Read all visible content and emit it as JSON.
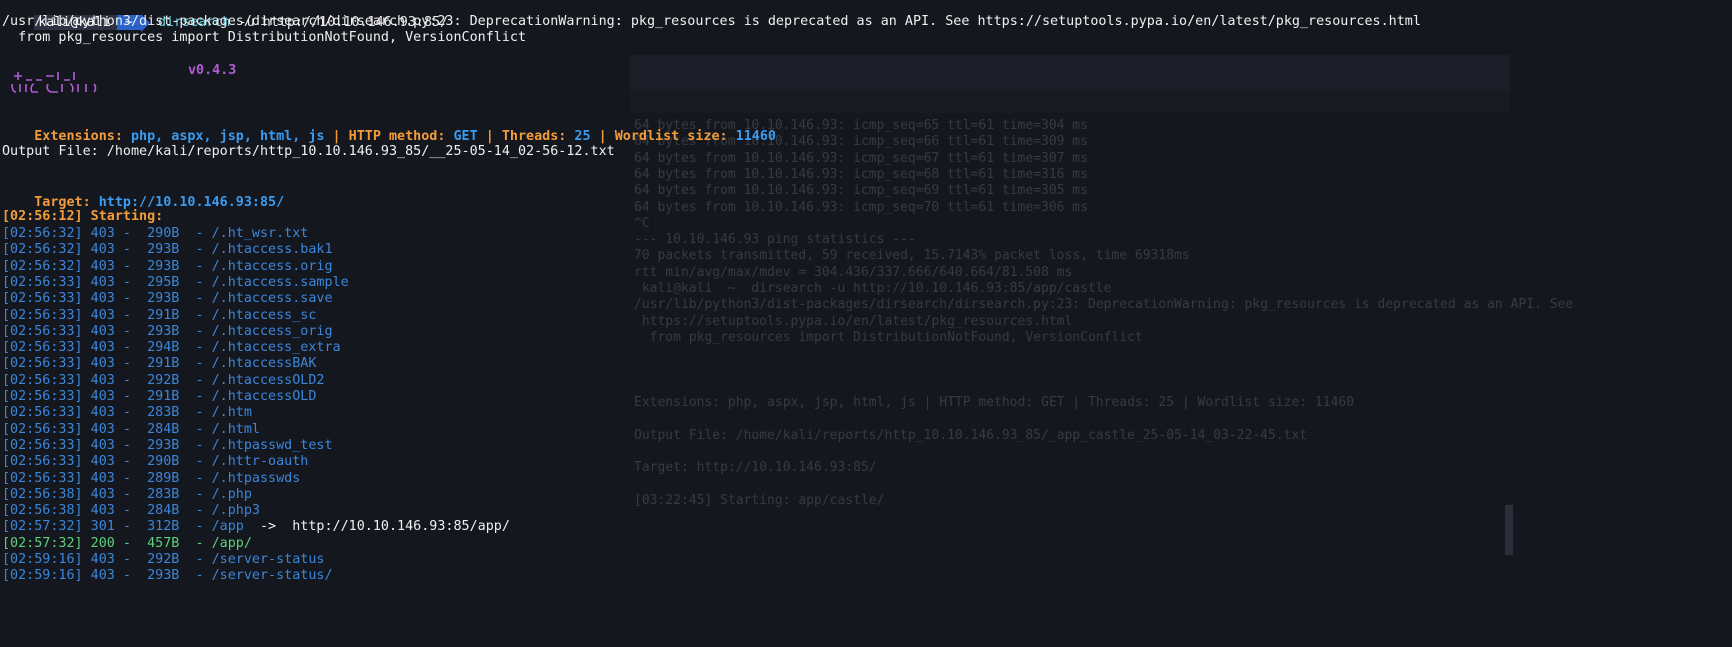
{
  "prompt": {
    "user": "kali@kali",
    "dir": "~",
    "command": "dirsearch",
    "args": "-u http://10.10.146.93:85/"
  },
  "warning": {
    "line1": "/usr/lib/python3/dist-packages/dirsearch/dirsearch.py:23: DeprecationWarning: pkg_resources is deprecated as an API. See https://setuptools.pypa.io/en/latest/pkg_resources.html",
    "line2": "  from pkg_resources import DistributionNotFound, VersionConflict"
  },
  "banner": {
    "version": "v0.4.3"
  },
  "config": {
    "ext_label": "Extensions:",
    "ext_value": "php, aspx, jsp, html, js",
    "sep": "|",
    "method_label": "HTTP method:",
    "method_value": "GET",
    "threads_label": "Threads:",
    "threads_value": "25",
    "wordlist_label": "Wordlist size:",
    "wordlist_value": "11460"
  },
  "output_file": "Output File: /home/kali/reports/http_10.10.146.93_85/__25-05-14_02-56-12.txt",
  "target": {
    "label": "Target:",
    "value": "http://10.10.146.93:85/"
  },
  "starting": "[02:56:12] Starting:",
  "results": [
    {
      "text": "[02:56:32] 403 -  290B  - /.ht_wsr.txt",
      "status": "403"
    },
    {
      "text": "[02:56:32] 403 -  293B  - /.htaccess.bak1",
      "status": "403"
    },
    {
      "text": "[02:56:32] 403 -  293B  - /.htaccess.orig",
      "status": "403"
    },
    {
      "text": "[02:56:33] 403 -  295B  - /.htaccess.sample",
      "status": "403"
    },
    {
      "text": "[02:56:33] 403 -  293B  - /.htaccess.save",
      "status": "403"
    },
    {
      "text": "[02:56:33] 403 -  291B  - /.htaccess_sc",
      "status": "403"
    },
    {
      "text": "[02:56:33] 403 -  293B  - /.htaccess_orig",
      "status": "403"
    },
    {
      "text": "[02:56:33] 403 -  294B  - /.htaccess_extra",
      "status": "403"
    },
    {
      "text": "[02:56:33] 403 -  291B  - /.htaccessBAK",
      "status": "403"
    },
    {
      "text": "[02:56:33] 403 -  292B  - /.htaccessOLD2",
      "status": "403"
    },
    {
      "text": "[02:56:33] 403 -  291B  - /.htaccessOLD",
      "status": "403"
    },
    {
      "text": "[02:56:33] 403 -  283B  - /.htm",
      "status": "403"
    },
    {
      "text": "[02:56:33] 403 -  284B  - /.html",
      "status": "403"
    },
    {
      "text": "[02:56:33] 403 -  293B  - /.htpasswd_test",
      "status": "403"
    },
    {
      "text": "[02:56:33] 403 -  290B  - /.httr-oauth",
      "status": "403"
    },
    {
      "text": "[02:56:33] 403 -  289B  - /.htpasswds",
      "status": "403"
    },
    {
      "text": "[02:56:38] 403 -  283B  - /.php",
      "status": "403"
    },
    {
      "text": "[02:56:38] 403 -  284B  - /.php3",
      "status": "403"
    },
    {
      "text": "[02:57:32] 301 -  312B  - /app",
      "status": "301",
      "redirect": "  ->  http://10.10.146.93:85/app/"
    },
    {
      "text": "[02:57:32] 200 -  457B  - /app/",
      "status": "200"
    },
    {
      "text": "[02:59:16] 403 -  292B  - /server-status",
      "status": "403"
    },
    {
      "text": "[02:59:16] 403 -  293B  - /server-status/",
      "status": "403"
    }
  ],
  "ghost": {
    "lines": [
      "64 bytes from 10.10.146.93: icmp_seq=65 ttl=61 time=304 ms",
      "64 bytes from 10.10.146.93: icmp_seq=66 ttl=61 time=309 ms",
      "64 bytes from 10.10.146.93: icmp_seq=67 ttl=61 time=307 ms",
      "64 bytes from 10.10.146.93: icmp_seq=68 ttl=61 time=316 ms",
      "64 bytes from 10.10.146.93: icmp_seq=69 ttl=61 time=305 ms",
      "64 bytes from 10.10.146.93: icmp_seq=70 ttl=61 time=306 ms",
      "^C",
      "--- 10.10.146.93 ping statistics ---",
      "70 packets transmitted, 59 received, 15.7143% packet loss, time 69318ms",
      "rtt min/avg/max/mdev = 304.436/337.666/640.664/81.508 ms",
      " kali@kali  ~  dirsearch -u http://10.10.146.93:85/app/castle",
      "/usr/lib/python3/dist-packages/dirsearch/dirsearch.py:23: DeprecationWarning: pkg_resources is deprecated as an API. See",
      " https://setuptools.pypa.io/en/latest/pkg_resources.html",
      "  from pkg_resources import DistributionNotFound, VersionConflict",
      "",
      "",
      "",
      "Extensions: php, aspx, jsp, html, js | HTTP method: GET | Threads: 25 | Wordlist size: 11460",
      "",
      "Output File: /home/kali/reports/http_10.10.146.93_85/_app_castle_25-05-14_03-22-45.txt",
      "",
      "Target: http://10.10.146.93:85/",
      "",
      "[03:22:45] Starting: app/castle/"
    ]
  },
  "colors": {
    "background": "#15171e",
    "orange": "#f39c3a",
    "blue": "#3a9cf0",
    "result_blue": "#3b86d9",
    "green": "#5ad17a",
    "purple": "#b25bd6"
  }
}
